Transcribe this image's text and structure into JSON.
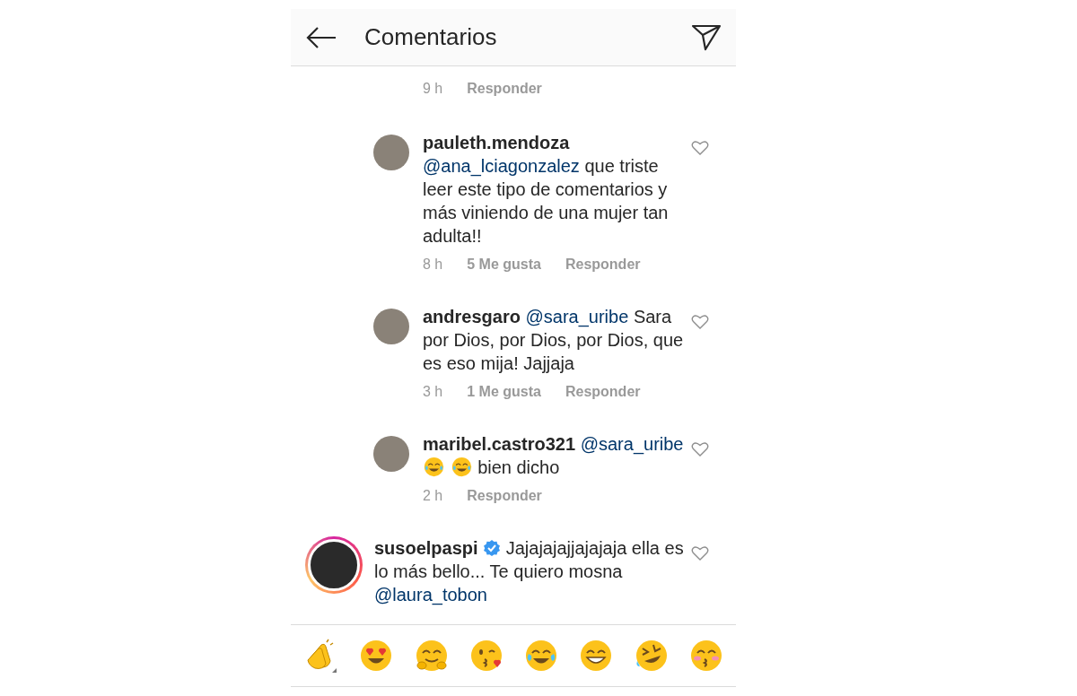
{
  "header": {
    "title": "Comentarios"
  },
  "partial_reply": {
    "time": "9 h",
    "reply": "Responder"
  },
  "comments": [
    {
      "kind": "reply",
      "user": "pauleth.mendoza",
      "verified": false,
      "story_ring": false,
      "mention": "@ana_lciagonzalez",
      "text": "que triste leer este tipo de comentarios y más viniendo de una mujer tan adulta!!",
      "time": "8 h",
      "likes": "5 Me gusta",
      "reply": "Responder"
    },
    {
      "kind": "reply",
      "user": "andresgaro",
      "verified": false,
      "story_ring": false,
      "mention": "@sara_uribe",
      "text": "Sara por Dios, por Dios, por Dios, que es eso mija! Jajjaja",
      "time": "3 h",
      "likes": "1 Me gusta",
      "reply": "Responder"
    },
    {
      "kind": "reply",
      "user": "maribel.castro321",
      "verified": false,
      "story_ring": false,
      "mention": "@sara_uribe",
      "inline_emojis": [
        {
          "kind": "tears-of-joy"
        },
        {
          "kind": "tears-of-joy"
        }
      ],
      "text": "bien dicho",
      "time": "2 h",
      "reply": "Responder"
    },
    {
      "kind": "comment",
      "user": "susoelpaspi",
      "verified": true,
      "story_ring": true,
      "text": "Jajajajajjajajaja ella es lo más bello... Te quiero mosna",
      "mention_after": "@laura_tobon"
    }
  ],
  "emoji_bar": [
    {
      "kind": "clap"
    },
    {
      "kind": "heart-eyes"
    },
    {
      "kind": "hug"
    },
    {
      "kind": "kiss"
    },
    {
      "kind": "tears-of-joy"
    },
    {
      "kind": "grin"
    },
    {
      "kind": "rofl"
    },
    {
      "kind": "kissing"
    }
  ]
}
